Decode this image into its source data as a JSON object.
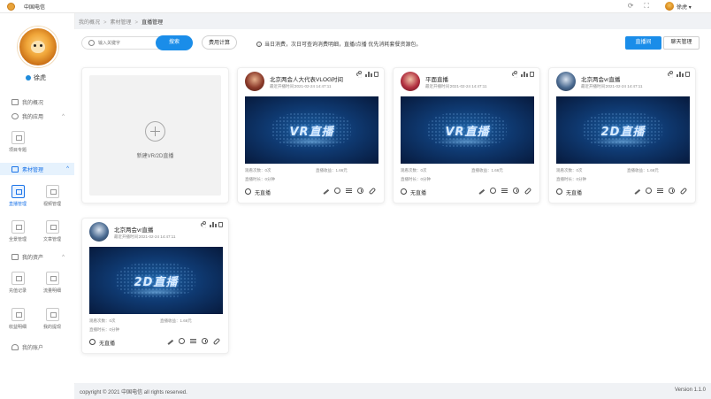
{
  "app": {
    "title": "中国电信"
  },
  "topbar": {
    "user_name": "徐虎"
  },
  "sidebar": {
    "user_name": "徐虎",
    "items": [
      {
        "label": "我的概况",
        "icon": "home-icon"
      },
      {
        "label": "我的应用",
        "icon": "app-icon"
      },
      {
        "label": "素材管理",
        "icon": "layers-icon"
      },
      {
        "label": "我的资产",
        "icon": "asset-icon"
      },
      {
        "label": "我的账户",
        "icon": "user-icon"
      }
    ],
    "tiles": {
      "app": [
        {
          "label": "项目专题"
        }
      ],
      "material": [
        {
          "label": "直播管理"
        },
        {
          "label": "视频管理"
        },
        {
          "label": "全景管理"
        },
        {
          "label": "文章管理"
        }
      ],
      "asset": [
        {
          "label": "充值记录"
        },
        {
          "label": "流量明细"
        },
        {
          "label": "收益明细"
        },
        {
          "label": "我的提现"
        }
      ]
    }
  },
  "breadcrumb": [
    "我的概况",
    "素材管理",
    "直播管理"
  ],
  "toolbar": {
    "search_placeholder": "输入关键字",
    "search_button": "搜索",
    "fee_button": "费用计算",
    "notice": "当日消费，次日可查询消费明细，直播/点播 优先消耗套餐资源包。",
    "tab_live": "直播间",
    "tab_chat": "聊天管理"
  },
  "new_card": {
    "label": "新建VR/2D直播"
  },
  "cards": [
    {
      "title": "北京两会人大代表VLOG时间",
      "time_label": "最近开播时间：",
      "time": "2021-02-24 14:47:11",
      "thumb_text": "VR直播",
      "views": "观看次数：0次",
      "income": "直播收益：1.66元",
      "duration": "直播时长：0分钟",
      "status": "无直播"
    },
    {
      "title": "平面直播",
      "time_label": "最近开播时间：",
      "time": "2021-02-24 14:47:11",
      "thumb_text": "VR直播",
      "views": "观看次数：0次",
      "income": "直播收益：1.66元",
      "duration": "直播时长：0分钟",
      "status": "无直播"
    },
    {
      "title": "北京两会vr直播",
      "time_label": "最近开播时间：",
      "time": "2021-02-24 14:47:11",
      "thumb_text": "2D直播",
      "views": "观看次数：0次",
      "income": "直播收益：1.66元",
      "duration": "直播时长：0分钟",
      "status": "无直播"
    },
    {
      "title": "北京两会vr直播",
      "time_label": "最近开播时间：",
      "time": "2021-02-24 14:47:11",
      "thumb_text": "2D直播",
      "views": "观看次数：0次",
      "income": "直播收益：1.66元",
      "duration": "直播时长：0分钟",
      "status": "无直播"
    }
  ],
  "footer": {
    "copyright": "copyright © 2021 中国电信 all rights reserved.",
    "version": "Version 1.1.0"
  },
  "colors": {
    "primary": "#1a8de9",
    "sidebar_active_bg": "#e6f2fd",
    "page_bg": "#f0f2f5"
  }
}
